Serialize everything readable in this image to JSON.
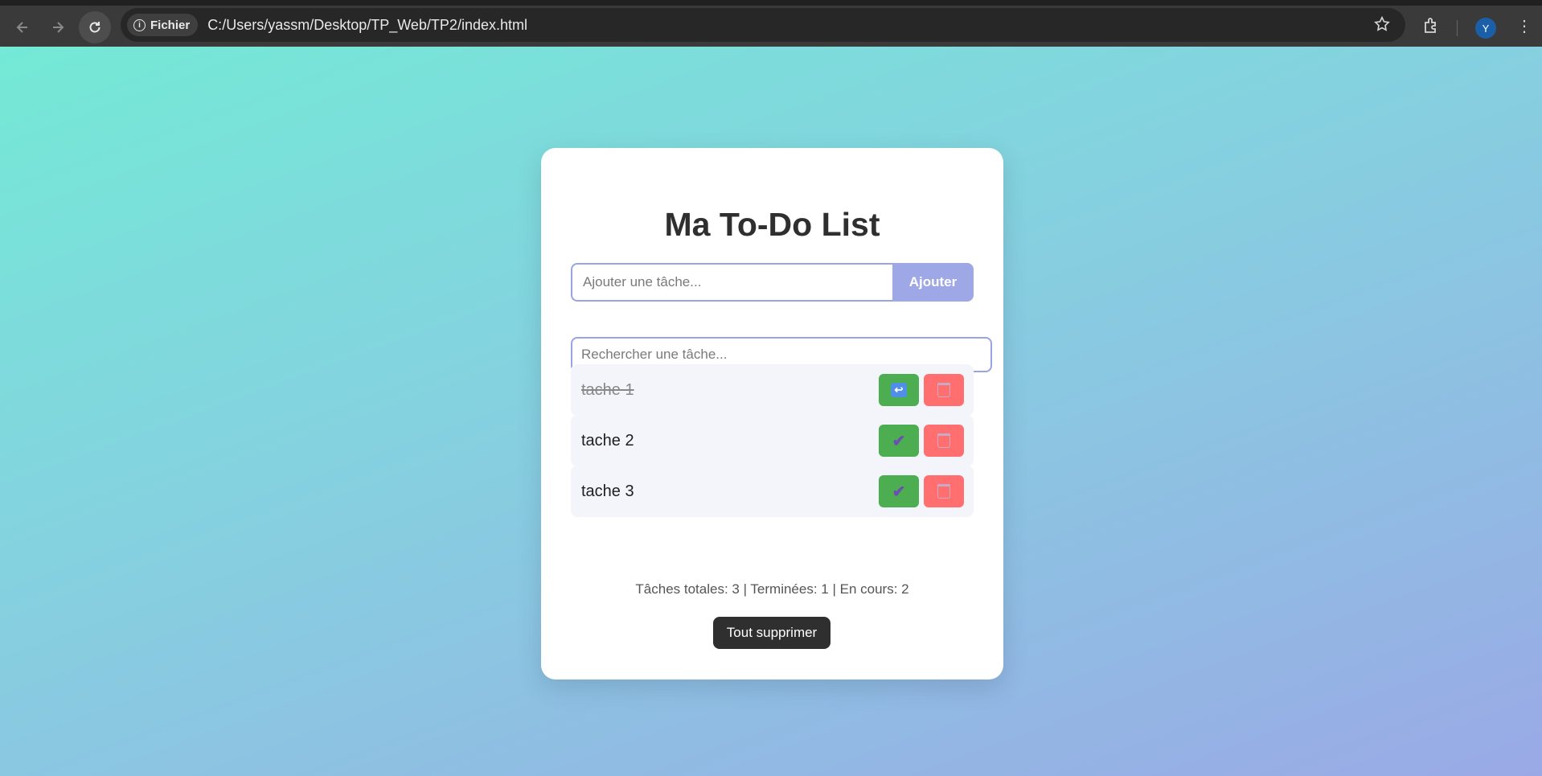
{
  "browser": {
    "site_chip": "Fichier",
    "url": "C:/Users/yassm/Desktop/TP_Web/TP2/index.html",
    "avatar_letter": "Y",
    "icons": [
      "back-arrow-icon",
      "forward-arrow-icon",
      "reload-icon",
      "info-icon",
      "star-icon",
      "extensions-icon",
      "kebab-menu-icon"
    ]
  },
  "app": {
    "title": "Ma To-Do List",
    "add_placeholder": "Ajouter une tâche...",
    "add_button": "Ajouter",
    "search_placeholder": "Rechercher une tâche...",
    "tasks": [
      {
        "label": "tache 1",
        "done": true
      },
      {
        "label": "tache 2",
        "done": false
      },
      {
        "label": "tache 3",
        "done": false
      }
    ],
    "stats": "Tâches totales: 3 | Terminées: 1 | En cours: 2",
    "clear_button": "Tout supprimer"
  },
  "colors": {
    "gradient_start": "#74e9d6",
    "gradient_end": "#9aa9e6",
    "complete_button": "#4cae50",
    "delete_button": "#ff6f6f",
    "add_button": "#9fa8e6",
    "clear_button": "#2f2f2f"
  }
}
